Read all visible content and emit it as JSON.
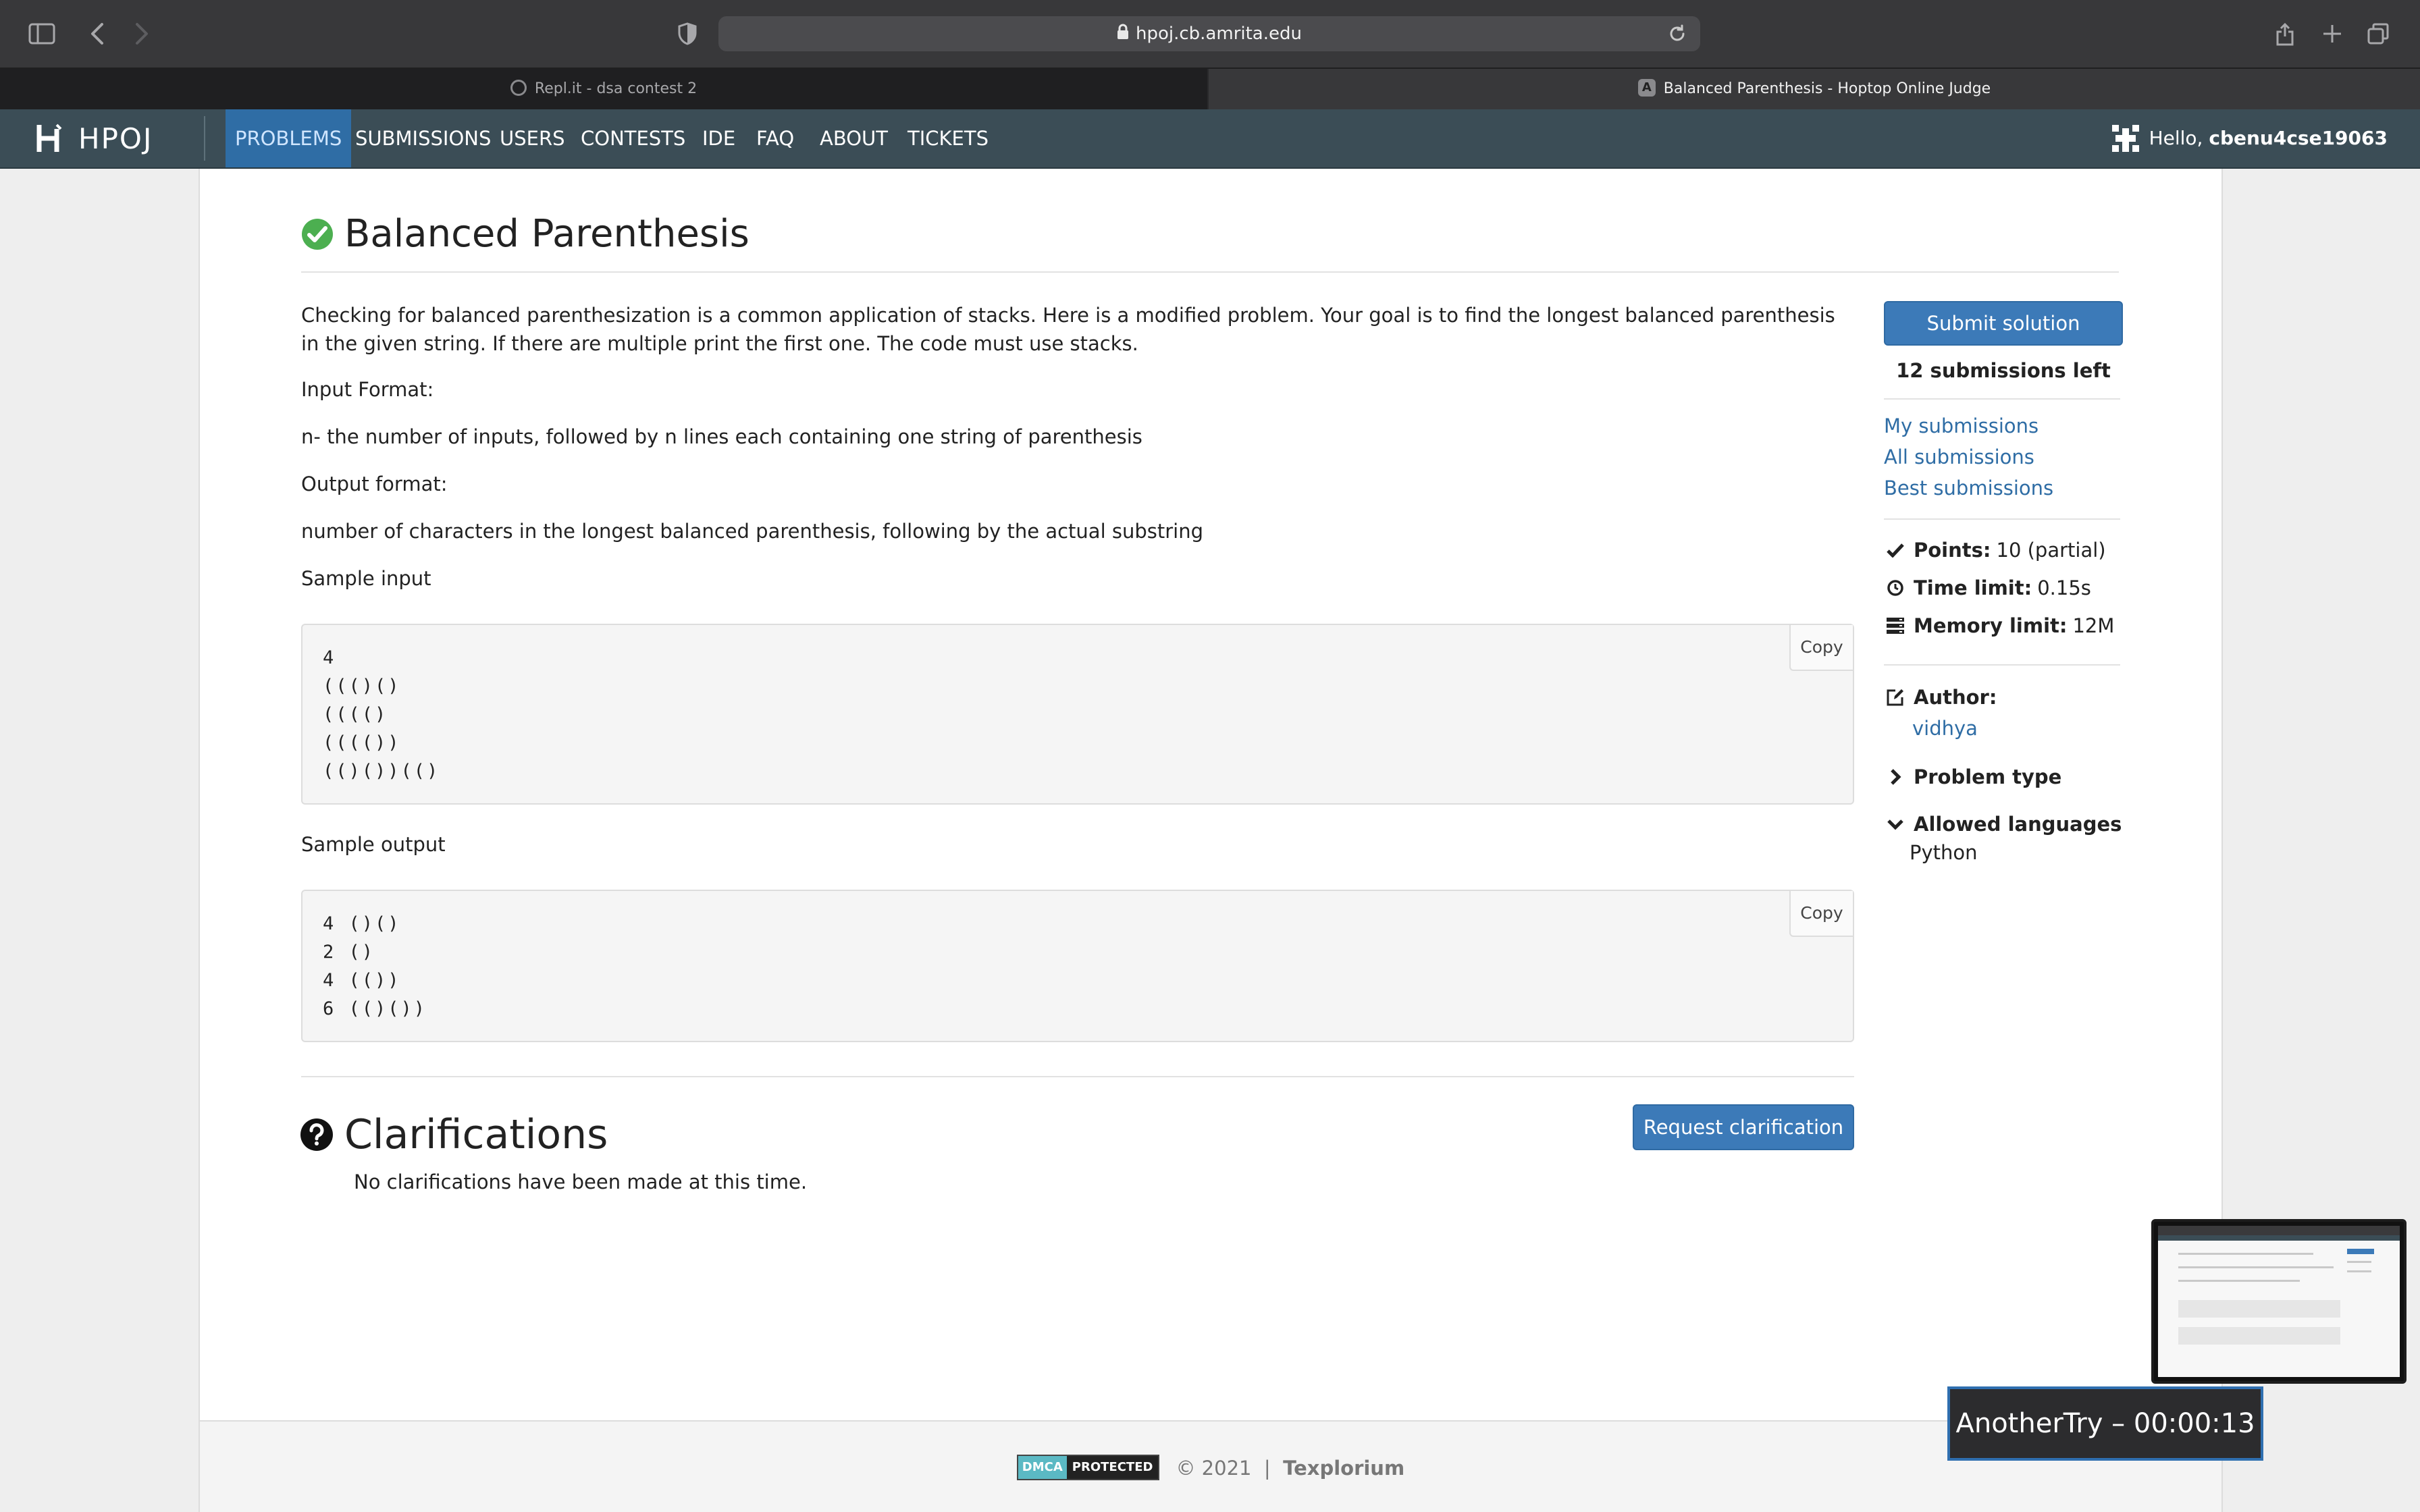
{
  "browser": {
    "url": "hpoj.cb.amrita.edu",
    "tabs": [
      {
        "title": "Repl.it - dsa contest 2"
      },
      {
        "title": "Balanced Parenthesis - Hoptop Online Judge",
        "favicon_letter": "A"
      }
    ]
  },
  "nav": {
    "logo": "HPOJ",
    "items": [
      "PROBLEMS",
      "SUBMISSIONS",
      "USERS",
      "CONTESTS",
      "IDE",
      "FAQ",
      "ABOUT",
      "TICKETS"
    ],
    "active": "PROBLEMS",
    "hello_prefix": "Hello,",
    "username": "cbenu4cse19063"
  },
  "problem": {
    "title": "Balanced Parenthesis",
    "description": "Checking for balanced parenthesization is a common application of stacks. Here is a modified problem. Your goal is to find the longest balanced parenthesis in the given string. If there are multiple print the first one. The code must use stacks.",
    "input_format_label": "Input Format:",
    "input_format": "n- the number of inputs, followed by n lines each containing one string of parenthesis",
    "output_format_label": "Output format:",
    "output_format": "number of characters in the longest balanced parenthesis, following by the actual substring",
    "sample_input_label": "Sample input",
    "sample_input": "4\n((()()\n(((()\n(((())\n(()())(()",
    "sample_output_label": "Sample output",
    "sample_output": "4 ()()\n2 ()\n4 (())\n6 (()())",
    "copy_label": "Copy"
  },
  "clarifications": {
    "heading": "Clarifications",
    "request_button": "Request clarification",
    "empty_text": "No clarifications have been made at this time."
  },
  "sidebar": {
    "submit_button": "Submit solution",
    "submissions_left": "12 submissions left",
    "links": [
      "My submissions",
      "All submissions",
      "Best submissions"
    ],
    "points_label": "Points:",
    "points_value": "10 (partial)",
    "time_label": "Time limit:",
    "time_value": "0.15s",
    "memory_label": "Memory limit:",
    "memory_value": "12M",
    "author_label": "Author:",
    "author": "vidhya",
    "problem_type_label": "Problem type",
    "allowed_languages_label": "Allowed languages",
    "allowed_languages": "Python"
  },
  "footer": {
    "dmca_left": "DMCA",
    "dmca_right": "PROTECTED",
    "copyright": "© 2021",
    "separator": "|",
    "brand": "Texplorium"
  },
  "overlay": {
    "timer": "AnotherTry – 00:00:13"
  },
  "colors": {
    "nav_bg": "#3b4d56",
    "nav_active": "#2f6da5",
    "primary_button": "#3c7ab8",
    "link": "#2f6da5",
    "success_icon": "#4caf50"
  }
}
